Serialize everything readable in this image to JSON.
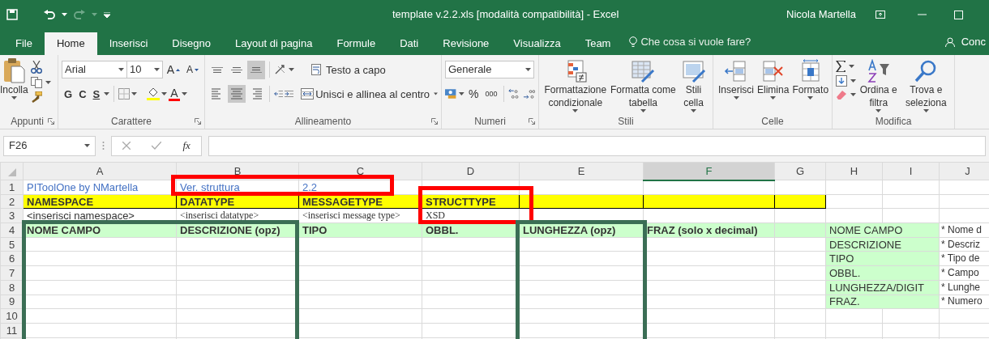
{
  "title_bar": {
    "title": "template v.2.2.xls [modalità compatibilità] - Excel",
    "user": "Nicola Martella"
  },
  "tabs": [
    {
      "label": "File",
      "selected": false
    },
    {
      "label": "Home",
      "selected": true
    },
    {
      "label": "Inserisci",
      "selected": false
    },
    {
      "label": "Disegno",
      "selected": false
    },
    {
      "label": "Layout di pagina",
      "selected": false
    },
    {
      "label": "Formule",
      "selected": false
    },
    {
      "label": "Dati",
      "selected": false
    },
    {
      "label": "Revisione",
      "selected": false
    },
    {
      "label": "Visualizza",
      "selected": false
    },
    {
      "label": "Team",
      "selected": false
    }
  ],
  "tell_me": "Che cosa si vuole fare?",
  "share": "Conc",
  "ribbon": {
    "clipboard": {
      "paste": "Incolla",
      "label": "Appunti"
    },
    "font": {
      "name": "Arial",
      "size": "10",
      "grow": "A",
      "shrink": "A",
      "bold": "G",
      "italic": "C",
      "underline": "S",
      "font_color_letter": "A",
      "label": "Carattere"
    },
    "alignment": {
      "vertical": [
        {
          "kind": "top",
          "selected": false
        },
        {
          "kind": "middle",
          "selected": false
        },
        {
          "kind": "bottom",
          "selected": true
        }
      ],
      "horizontal": [
        {
          "kind": "left",
          "selected": false
        },
        {
          "kind": "center",
          "selected": true
        },
        {
          "kind": "right",
          "selected": false
        }
      ],
      "wrap": "Testo a capo",
      "merge": "Unisci e allinea al centro",
      "label": "Allineamento"
    },
    "number": {
      "format": "Generale",
      "percent": "%",
      "thousands": "000",
      "label": "Numeri"
    },
    "styles": {
      "buttons": [
        {
          "kind": "conditional",
          "label": "Formattazione condizionale"
        },
        {
          "kind": "table",
          "label": "Formatta come tabella"
        },
        {
          "kind": "cell",
          "label": "Stili cella"
        }
      ],
      "label": "Stili"
    },
    "cells": {
      "buttons": [
        {
          "kind": "insert",
          "label": "Inserisci"
        },
        {
          "kind": "delete",
          "label": "Elimina"
        },
        {
          "kind": "format",
          "label": "Formato"
        }
      ],
      "label": "Celle"
    },
    "editing": {
      "buttons": [
        {
          "kind": "sort",
          "label": "Ordina e filtra"
        },
        {
          "kind": "find",
          "label": "Trova e seleziona"
        }
      ],
      "label": "Modifica"
    }
  },
  "formula_bar": {
    "name_box": "F26",
    "function_label": "fx"
  },
  "sheet": {
    "columns": [
      {
        "label": "A",
        "selected": false
      },
      {
        "label": "B",
        "selected": false
      },
      {
        "label": "C",
        "selected": false
      },
      {
        "label": "D",
        "selected": false
      },
      {
        "label": "E",
        "selected": false
      },
      {
        "label": "F",
        "selected": true
      },
      {
        "label": "G",
        "selected": false
      },
      {
        "label": "H",
        "selected": false
      },
      {
        "label": "I",
        "selected": false
      },
      {
        "label": "J",
        "selected": false
      }
    ],
    "rows": [
      {
        "number": "1",
        "kind": "info",
        "cells": [
          {
            "text": "PIToolOne by NMartella"
          },
          {
            "text": "Ver. struttura"
          },
          {
            "text": "2.2"
          }
        ]
      },
      {
        "number": "2",
        "kind": "section",
        "cells": [
          {
            "text": "NAMESPACE"
          },
          {
            "text": "DATATYPE"
          },
          {
            "text": "MESSAGETYPE"
          },
          {
            "text": "STRUCTTYPE"
          }
        ]
      },
      {
        "number": "3",
        "kind": "input",
        "cells": [
          {
            "text": "<inserisci namespace>",
            "kind": "plain"
          },
          {
            "text": "<inserisci datatype>",
            "kind": "serif"
          },
          {
            "text": "<inserisci message type>",
            "kind": "serif"
          },
          {
            "text": "XSD",
            "kind": "serif"
          }
        ]
      },
      {
        "number": "4",
        "kind": "fields",
        "cells": [
          {
            "text": "NOME CAMPO"
          },
          {
            "text": "DESCRIZIONE (opz)"
          },
          {
            "text": "TIPO"
          },
          {
            "text": "OBBL."
          },
          {
            "text": "LUNGHEZZA (opz)"
          },
          {
            "text": "FRAZ (solo x decimal)"
          }
        ],
        "legend": {
          "field": "NOME CAMPO",
          "note": "* Nome d"
        }
      },
      {
        "number": "5",
        "kind": "empty",
        "cells": [],
        "legend": {
          "field": "DESCRIZIONE",
          "note": "* Descriz"
        }
      },
      {
        "number": "6",
        "kind": "empty",
        "cells": [],
        "legend": {
          "field": "TIPO",
          "note": "* Tipo de"
        }
      },
      {
        "number": "7",
        "kind": "empty",
        "cells": [],
        "legend": {
          "field": "OBBL.",
          "note": "* Campo"
        }
      },
      {
        "number": "8",
        "kind": "empty",
        "cells": [],
        "legend": {
          "field": "LUNGHEZZA/DIGIT",
          "note": "* Lunghe"
        }
      },
      {
        "number": "9",
        "kind": "empty",
        "cells": [],
        "legend": {
          "field": "FRAZ.",
          "note": "* Numero"
        }
      },
      {
        "number": "10",
        "kind": "empty",
        "cells": []
      },
      {
        "number": "11",
        "kind": "empty",
        "cells": []
      }
    ]
  }
}
